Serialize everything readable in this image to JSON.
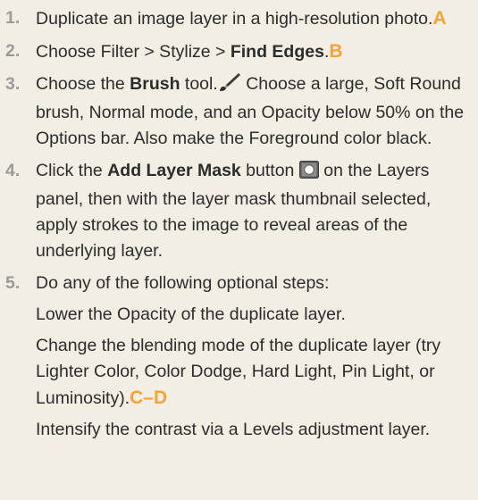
{
  "steps": [
    {
      "num": "1.",
      "text": "Duplicate an image layer in a high-resolution photo.",
      "callout": "A"
    },
    {
      "num": "2.",
      "pre": "Choose Filter > Stylize > ",
      "bold": "Find Edges",
      "post": ".",
      "callout": "B"
    },
    {
      "num": "3.",
      "pre": "Choose the ",
      "bold": "Brush",
      "mid": " tool.",
      "icon": "brush-icon",
      "post": " Choose a large, Soft Round brush, Normal mode, and an Opacity below 50% on the Options bar. Also make the Foreground color black."
    },
    {
      "num": "4.",
      "pre": "Click the ",
      "bold": "Add Layer Mask",
      "mid": " button ",
      "icon": "layer-mask-icon",
      "post": " on the Layers panel, then with the layer mask thumbnail selected, apply strokes to the image to reveal areas of the underlying layer."
    },
    {
      "num": "5.",
      "text": "Do any of the following optional steps:",
      "subs": [
        "Lower the Opacity of the duplicate layer.",
        "Change the blending mode of the duplicate layer (try Lighter Color, Color Dodge, Hard Light, Pin Light, or Luminosity).",
        "Intensify the contrast via a Levels adjustment layer."
      ],
      "sub_callout": "C–D"
    }
  ],
  "colors": {
    "background": "#f3eee4",
    "step_number": "#9a9a9a",
    "callout": "#f2a33a",
    "text": "#2c2c2c"
  }
}
